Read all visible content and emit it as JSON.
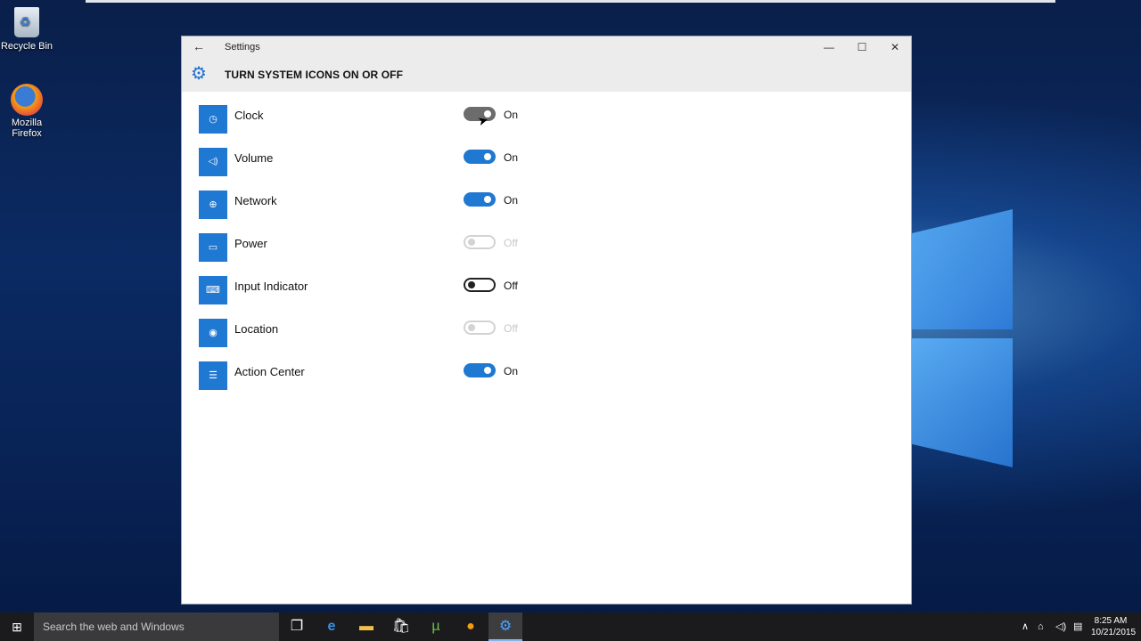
{
  "desktop": {
    "icons": [
      {
        "label": "Recycle Bin",
        "icon": "recycle-bin-icon"
      },
      {
        "label": "Mozilla Firefox",
        "icon": "firefox-icon"
      }
    ]
  },
  "window": {
    "title": "Settings",
    "back_icon": "back-arrow-icon",
    "controls": {
      "minimize": "—",
      "maximize": "☐",
      "close": "✕"
    },
    "heading": "TURN SYSTEM ICONS ON OR OFF",
    "heading_icon": "gear-icon"
  },
  "items": [
    {
      "label": "Clock",
      "state": "On",
      "toggle": "on",
      "icon": "clock-icon",
      "glyph": "◷"
    },
    {
      "label": "Volume",
      "state": "On",
      "toggle": "on",
      "icon": "volume-icon",
      "glyph": "🔊"
    },
    {
      "label": "Network",
      "state": "On",
      "toggle": "on",
      "icon": "network-icon",
      "glyph": "⊕"
    },
    {
      "label": "Power",
      "state": "Off",
      "toggle": "disabled",
      "icon": "battery-icon",
      "glyph": "▭"
    },
    {
      "label": "Input Indicator",
      "state": "Off",
      "toggle": "off",
      "icon": "keyboard-icon",
      "glyph": "⌨"
    },
    {
      "label": "Location",
      "state": "Off",
      "toggle": "disabled",
      "icon": "location-icon",
      "glyph": "◉"
    },
    {
      "label": "Action Center",
      "state": "On",
      "toggle": "on",
      "icon": "action-center-icon",
      "glyph": "☰"
    }
  ],
  "taskbar": {
    "search_placeholder": "Search the web and Windows",
    "time": "8:25 AM",
    "date": "10/21/2015"
  },
  "colors": {
    "accent": "#1f78d1",
    "toggle_pressed": "#6c6c6c",
    "disabled": "#d3d3d3"
  }
}
